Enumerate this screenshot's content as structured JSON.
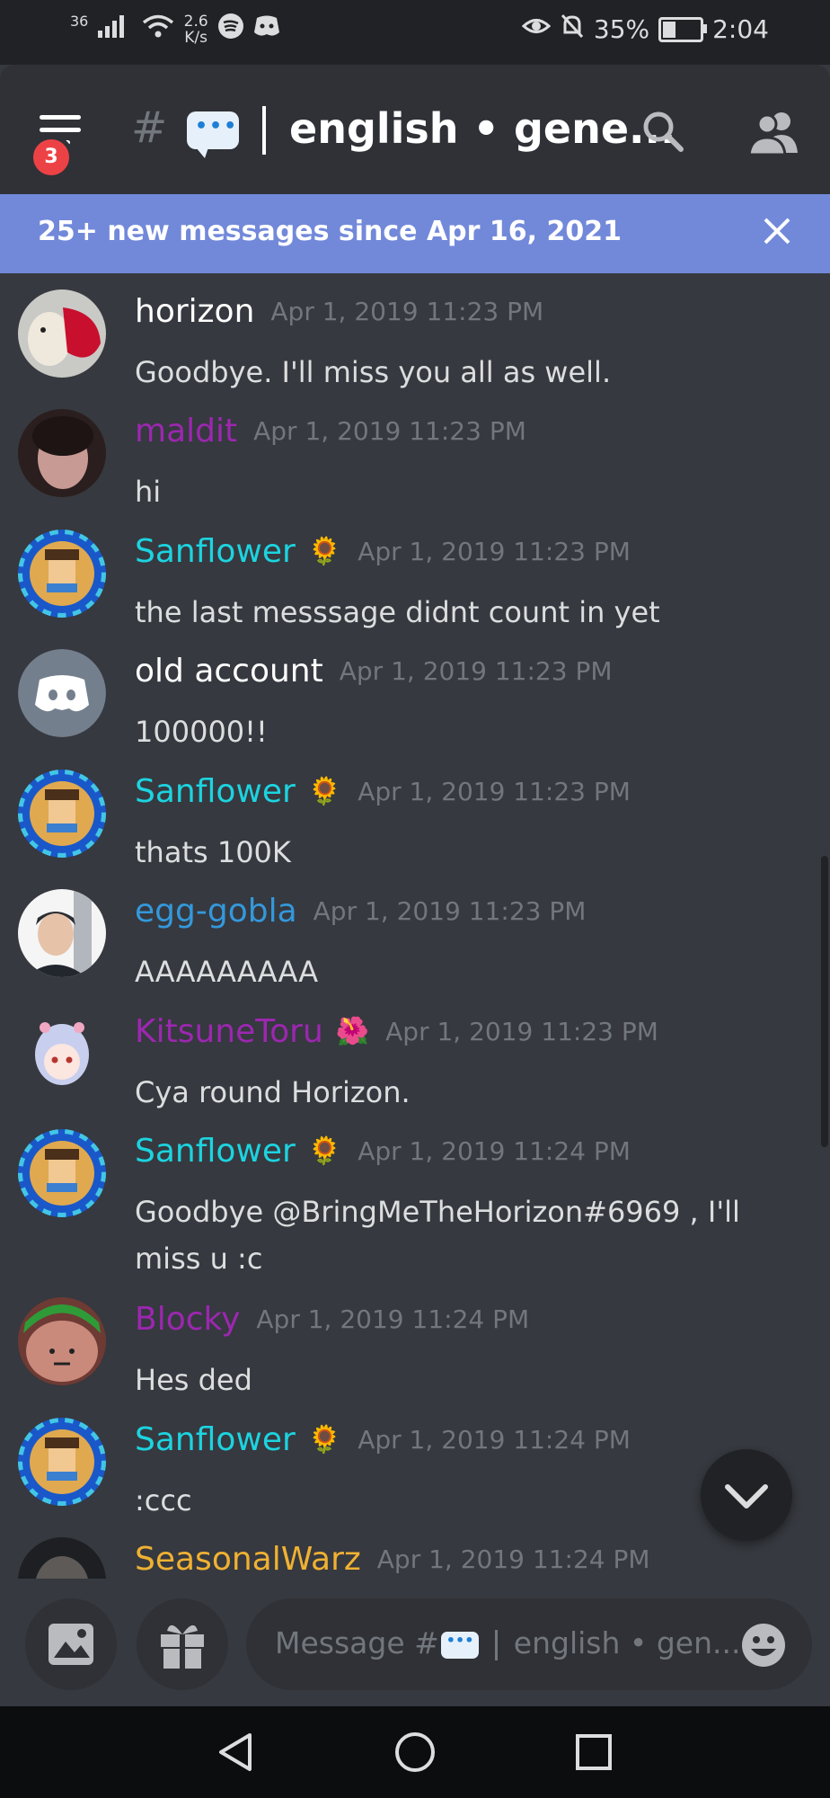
{
  "status_bar": {
    "signal_label": "36",
    "speed_value": "2.6",
    "speed_unit": "K/s",
    "battery": "35%",
    "battery_level": 0.35,
    "time": "2:04"
  },
  "header": {
    "menu_badge": "3",
    "channel_title": "english • gene..."
  },
  "banner": {
    "text": "25+ new messages since Apr 16, 2021"
  },
  "messages": [
    {
      "author": "horizon",
      "color": "#ffffff",
      "deco": "",
      "time": "Apr 1, 2019 11:23 PM",
      "text": "Goodbye. I'll miss you all as well."
    },
    {
      "author": "maldit",
      "color": "#9c27b0",
      "deco": "",
      "time": "Apr 1, 2019 11:23 PM",
      "text": "hi"
    },
    {
      "author": "Sanflower",
      "color": "#1cd4e0",
      "deco": "🌻",
      "time": "Apr 1, 2019 11:23 PM",
      "text": "the last messsage didnt count in yet"
    },
    {
      "author": "old account",
      "color": "#ffffff",
      "deco": "",
      "time": "Apr 1, 2019 11:23 PM",
      "text": "100000!!"
    },
    {
      "author": "Sanflower",
      "color": "#1cd4e0",
      "deco": "🌻",
      "time": "Apr 1, 2019 11:23 PM",
      "text": "thats 100K"
    },
    {
      "author": "egg-gobla",
      "color": "#3498db",
      "deco": "",
      "time": "Apr 1, 2019 11:23 PM",
      "text": "AAAAAAAAA"
    },
    {
      "author": "KitsuneToru",
      "color": "#9c27b0",
      "deco": "🌺",
      "time": "Apr 1, 2019 11:23 PM",
      "text": "Cya round Horizon."
    },
    {
      "author": "Sanflower",
      "color": "#1cd4e0",
      "deco": "🌻",
      "time": "Apr 1, 2019 11:24 PM",
      "text": "Goodbye @BringMeTheHorizon#6969 , I'll miss u :c"
    },
    {
      "author": "Blocky",
      "color": "#9c27b0",
      "deco": "",
      "time": "Apr 1, 2019 11:24 PM",
      "text": "Hes ded"
    },
    {
      "author": "Sanflower",
      "color": "#1cd4e0",
      "deco": "🌻",
      "time": "Apr 1, 2019 11:24 PM",
      "text": ":ccc"
    },
    {
      "author": "SeasonalWarz",
      "color": "#f0b132",
      "deco": "",
      "time": "Apr 1, 2019 11:24 PM",
      "text": ""
    }
  ],
  "composer": {
    "placeholder_prefix": "Message #",
    "placeholder_channel": "english • gen..."
  },
  "colors": {
    "accent_banner": "#7289da",
    "background": "#36393f",
    "header": "#2f3136"
  }
}
